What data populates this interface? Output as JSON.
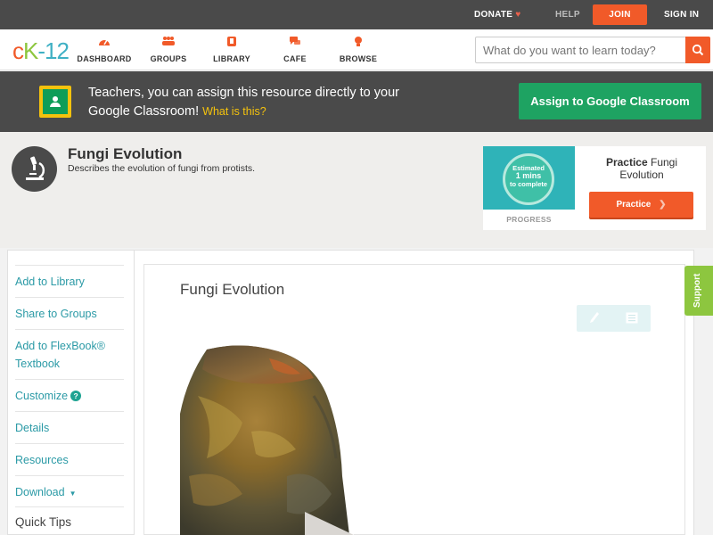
{
  "topbar": {
    "donate": "DONATE",
    "help": "HELP",
    "join": "JOIN",
    "signin": "SIGN IN"
  },
  "nav": {
    "logo": {
      "c": "c",
      "k": "K",
      "n": "-12"
    },
    "items": [
      {
        "label": "DASHBOARD",
        "icon": "dashboard-icon"
      },
      {
        "label": "GROUPS",
        "icon": "groups-icon"
      },
      {
        "label": "LIBRARY",
        "icon": "library-icon"
      },
      {
        "label": "CAFE",
        "icon": "cafe-icon"
      },
      {
        "label": "BROWSE",
        "icon": "browse-icon"
      }
    ],
    "search_placeholder": "What do you want to learn today?"
  },
  "classroom_banner": {
    "text": "Teachers, you can assign this resource directly to your Google Classroom!",
    "what_is_this": "What is this?",
    "button": "Assign to Google Classroom"
  },
  "header": {
    "title": "Fungi Evolution",
    "description": "Describes the evolution of fungi from protists."
  },
  "practice": {
    "estimated": "Estimated",
    "mins": "1 mins",
    "to_complete": "to complete",
    "progress_label": "PROGRESS",
    "title_bold": "Practice",
    "title_rest": "Fungi Evolution",
    "button": "Practice"
  },
  "sidebar": {
    "items": [
      "Add to Library",
      "Share to Groups",
      "Add to FlexBook® Textbook",
      "Customize",
      "Details",
      "Resources",
      "Download"
    ],
    "help_badge": "?",
    "caret": "▼",
    "quick_tips": "Quick Tips"
  },
  "content": {
    "title": "Fungi Evolution"
  },
  "support_tab": "Support",
  "colors": {
    "brand_orange": "#f15a29",
    "brand_green": "#8dc63f",
    "classroom_green": "#1ea362",
    "link_teal": "#2b9aa6",
    "dark_bar": "#4a4a4a"
  }
}
